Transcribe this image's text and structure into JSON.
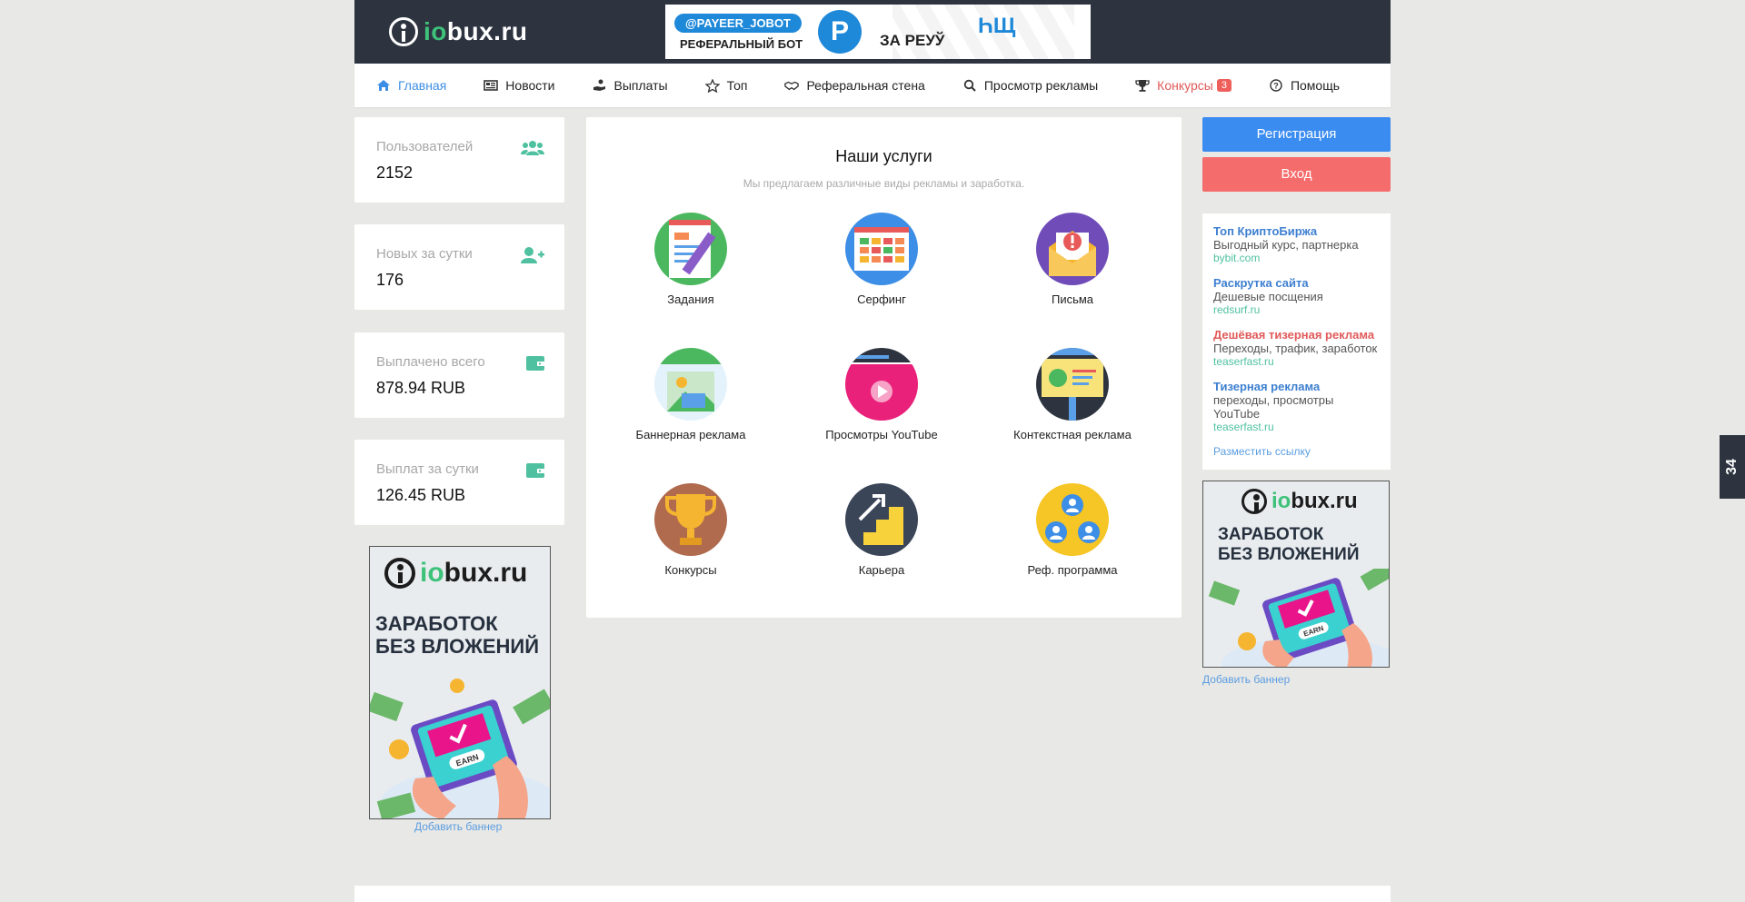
{
  "logo": {
    "part_green": "io",
    "part_white": "bux.ru"
  },
  "top_banner": {
    "pill": "@PAYEER_JOBOT",
    "subtitle": "РЕФЕРАЛЬНЫЙ БОТ",
    "letter": "P",
    "za": "ЗА PEУЎ",
    "glyph": "ҺЩ"
  },
  "nav": [
    {
      "label": "Главная",
      "icon": "home-icon",
      "state": "active"
    },
    {
      "label": "Новости",
      "icon": "newspaper-icon"
    },
    {
      "label": "Выплаты",
      "icon": "hand-coin-icon"
    },
    {
      "label": "Топ",
      "icon": "star-icon"
    },
    {
      "label": "Реферальная стена",
      "icon": "handshake-icon"
    },
    {
      "label": "Просмотр рекламы",
      "icon": "search-icon"
    },
    {
      "label": "Конкурсы",
      "icon": "trophy-icon",
      "state": "highlight",
      "badge": "3"
    },
    {
      "label": "Помощь",
      "icon": "question-circle-icon"
    }
  ],
  "stats": [
    {
      "label": "Пользователей",
      "value": "2152",
      "icon": "users-icon"
    },
    {
      "label": "Новых за сутки",
      "value": "176",
      "icon": "user-plus-icon"
    },
    {
      "label": "Выплачено всего",
      "value": "878.94 RUB",
      "icon": "wallet-icon"
    },
    {
      "label": "Выплат за сутки",
      "value": "126.45 RUB",
      "icon": "wallet-icon"
    }
  ],
  "services": {
    "title": "Наши услуги",
    "subtitle": "Мы предлагаем различные виды рекламы и заработка.",
    "items": [
      {
        "label": "Задания",
        "icon": "tasks-icon"
      },
      {
        "label": "Серфинг",
        "icon": "surfing-icon"
      },
      {
        "label": "Письма",
        "icon": "letters-icon"
      },
      {
        "label": "Баннерная реклама",
        "icon": "banner-ads-icon"
      },
      {
        "label": "Просмотры YouTube",
        "icon": "youtube-views-icon"
      },
      {
        "label": "Контекстная реклама",
        "icon": "context-ads-icon"
      },
      {
        "label": "Конкурсы",
        "icon": "contests-icon"
      },
      {
        "label": "Карьера",
        "icon": "career-icon"
      },
      {
        "label": "Реф. программа",
        "icon": "referral-program-icon"
      }
    ]
  },
  "buttons": {
    "register": "Регистрация",
    "login": "Вход"
  },
  "links": [
    {
      "title": "Топ КриптоБиржа",
      "desc": "Выгодный курс, партнерка",
      "url": "bybit.com",
      "color": "#3d7fd0"
    },
    {
      "title": "Раскрутка сайта",
      "desc": "Дешевые посщения",
      "url": "redsurf.ru",
      "color": "#3d7fd0"
    },
    {
      "title": "Дешёвая тизерная реклама",
      "desc": "Переходы, трафик, заработок",
      "url": "teaserfast.ru",
      "color": "#e05a5a"
    },
    {
      "title": "Тизерная реклама",
      "desc": "переходы, просмотры YouTube",
      "url": "teaserfast.ru",
      "color": "#3d7fd0"
    }
  ],
  "post_link": "Разместить ссылку",
  "ad": {
    "line1": "ЗАРАБОТОК",
    "line2": "БЕЗ ВЛОЖЕНИЙ",
    "earn": "EARN"
  },
  "add_banner": "Добавить баннер",
  "side_tab": "34"
}
